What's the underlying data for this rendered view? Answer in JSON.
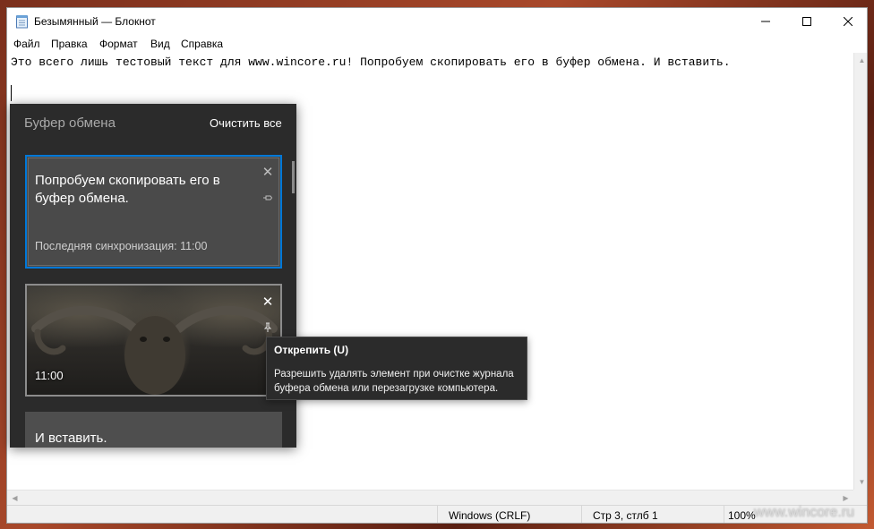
{
  "window": {
    "title": "Безымянный — Блокнот"
  },
  "menu": {
    "items": [
      "Файл",
      "Правка",
      "Формат",
      "Вид",
      "Справка"
    ]
  },
  "editor": {
    "line1": "Это всего лишь тестовый текст для www.wincore.ru! Попробуем скопировать его в буфер обмена. И вставить."
  },
  "status": {
    "encoding": "Windows (CRLF)",
    "position": "Стр 3, стлб 1",
    "zoom": "100%"
  },
  "watermark": "www.wincore.ru",
  "clipboard": {
    "header": "Буфер обмена",
    "clear_all": "Очистить все",
    "items": [
      {
        "text": "Попробуем скопировать его в буфер обмена.",
        "sync": "Последняя синхронизация: 11:00",
        "pinned": false
      },
      {
        "type": "image",
        "time": "11:00",
        "pinned": true
      },
      {
        "text": "И вставить."
      }
    ]
  },
  "tooltip": {
    "title": "Открепить (U)",
    "body": "Разрешить удалять элемент при очистке журнала буфера обмена или перезагрузке компьютера."
  },
  "icons": {
    "app": "notepad-icon",
    "minimize": "minimize-icon",
    "maximize": "maximize-icon",
    "close": "close-icon",
    "pin": "pin-icon"
  },
  "colors": {
    "accent": "#0078d7",
    "panel_bg": "#2b2b2b",
    "card_bg": "#4a4a4a"
  }
}
